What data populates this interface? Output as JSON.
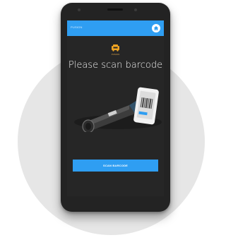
{
  "app": {
    "title": "PUSION"
  },
  "logo": {
    "text": "PUSION"
  },
  "main": {
    "heading": "Please scan barcode"
  },
  "action": {
    "scan_label": "SCAN BARCODE"
  },
  "colors": {
    "accent": "#2f9ef2",
    "screen_bg": "#262626",
    "logo": "#f0a422"
  },
  "icons": {
    "home": "home-icon",
    "logo": "truck-logo-icon"
  }
}
